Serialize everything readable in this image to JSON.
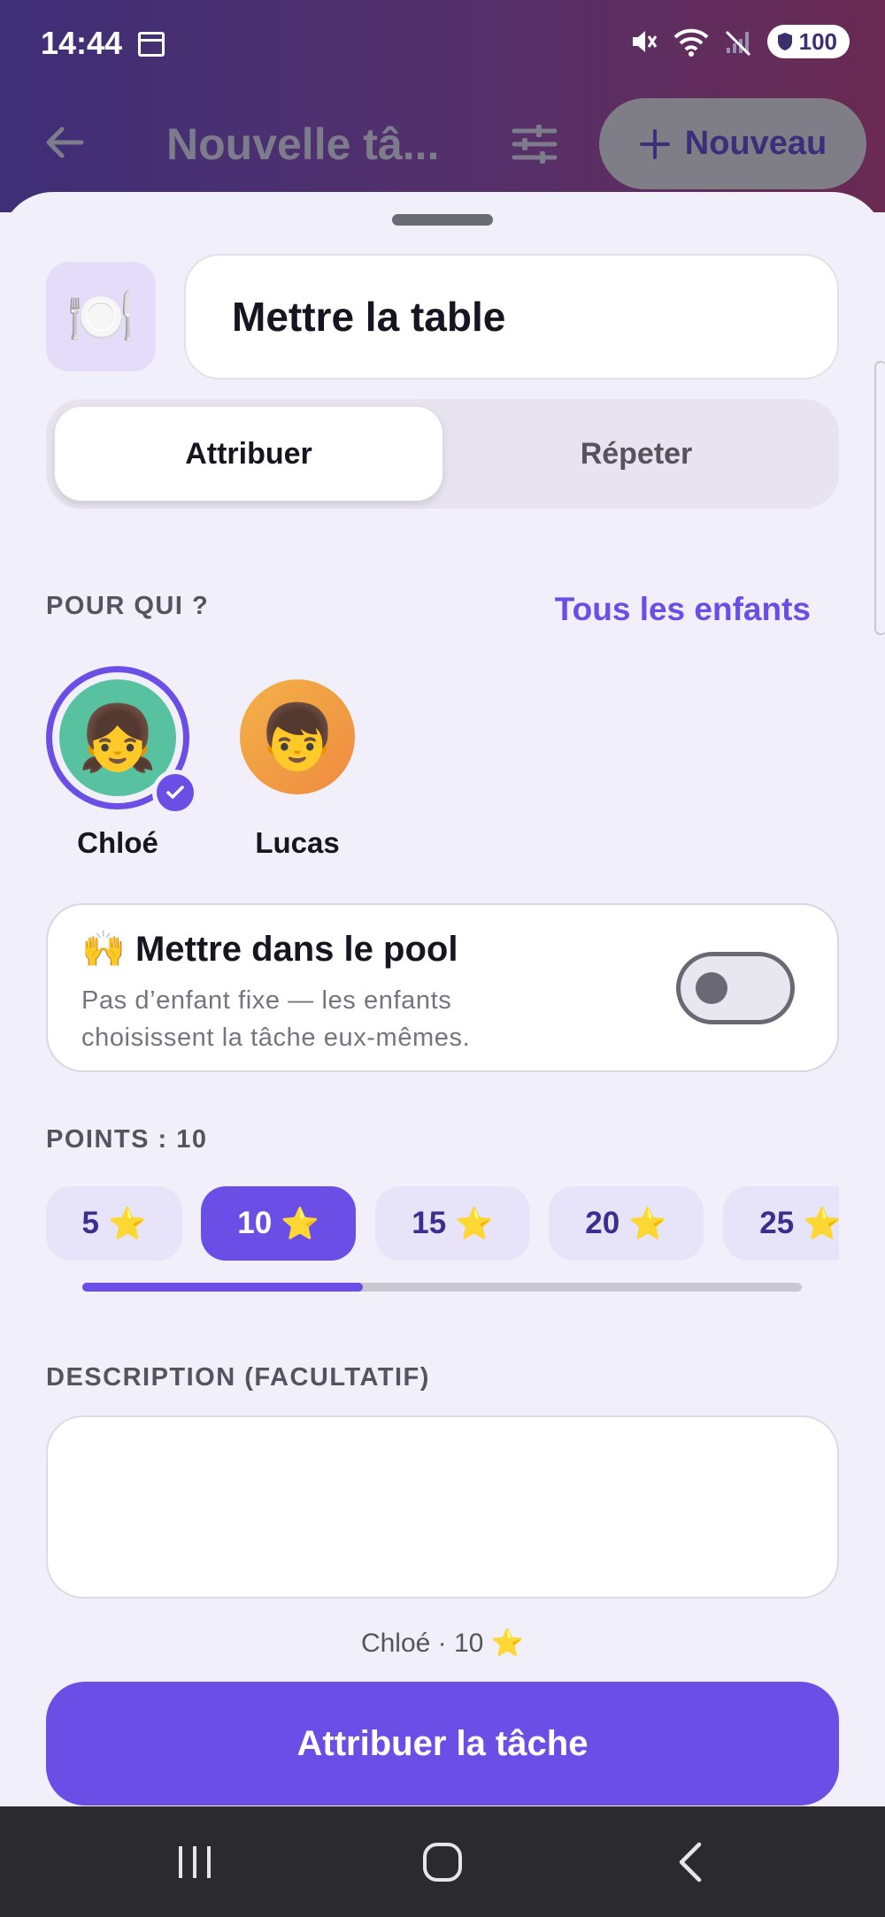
{
  "status_bar": {
    "time": "14:44",
    "battery": "100"
  },
  "header": {
    "title": "Nouvelle tâ...",
    "new_button_label": "Nouveau"
  },
  "task": {
    "icon": "🍽️",
    "title": "Mettre la table"
  },
  "mode_tabs": {
    "active": "Attribuer",
    "inactive": "Répeter"
  },
  "assign": {
    "section_label": "POUR QUI ?",
    "all_children_link": "Tous les enfants",
    "children": [
      {
        "name": "Chloé",
        "emoji": "👧",
        "selected": true,
        "color": "#58c2a0"
      },
      {
        "name": "Lucas",
        "emoji": "👦",
        "selected": false,
        "color": "#f09a44"
      }
    ]
  },
  "pool": {
    "emoji": "🙌",
    "title": "Mettre dans le pool",
    "description": "Pas d’enfant fixe — les enfants choisissent la tâche eux-mêmes.",
    "enabled": false
  },
  "points": {
    "section_label": "POINTS : 10",
    "options": [
      "5",
      "10",
      "15",
      "20",
      "25"
    ],
    "selected": "10",
    "star": "⭐"
  },
  "description": {
    "section_label": "DESCRIPTION (FACULTATIF)",
    "value": ""
  },
  "summary": "Chloé · 10 ⭐",
  "submit_label": "Attribuer la tâche",
  "colors": {
    "accent": "#6b4ee6",
    "background": "#f1eff9"
  }
}
